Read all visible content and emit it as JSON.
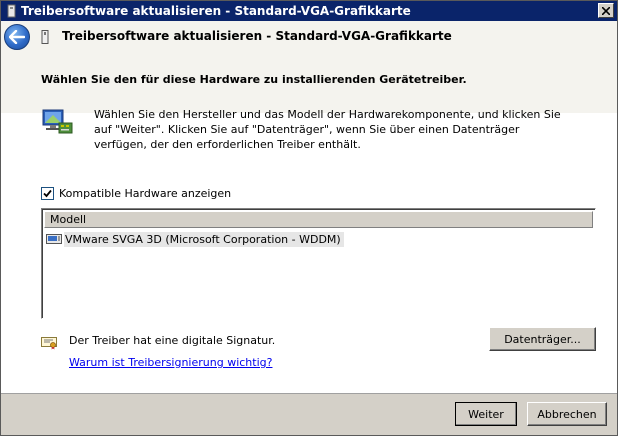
{
  "window": {
    "title": "Treibersoftware aktualisieren - Standard-VGA-Grafikkarte",
    "close_label": "✕"
  },
  "header": {
    "title": "Treibersoftware aktualisieren - Standard-VGA-Grafikkarte",
    "back_icon": "arrow-left-icon"
  },
  "main": {
    "heading": "Wählen Sie den für diese Hardware zu installierenden Gerätetreiber.",
    "description": "Wählen Sie den Hersteller und das Modell der Hardwarekomponente, und klicken Sie auf \"Weiter\". Klicken Sie auf \"Datenträger\", wenn Sie über einen Datenträger verfügen, der den erforderlichen Treiber enthält.",
    "compatible_checkbox": {
      "label": "Kompatible Hardware anzeigen",
      "checked": true
    },
    "model_list": {
      "column_header": "Modell",
      "items": [
        {
          "label": "VMware SVGA 3D (Microsoft Corporation - WDDM)",
          "selected": true
        }
      ]
    },
    "signature": {
      "text": "Der Treiber hat eine digitale Signatur.",
      "link": "Warum ist Treibersignierung wichtig?"
    },
    "disk_button": "Datenträger..."
  },
  "footer": {
    "next_button": "Weiter",
    "cancel_button": "Abbrechen"
  },
  "colors": {
    "titlebar": "#0a246a",
    "link": "#0000ee",
    "dialog_bg": "#d4d0c8"
  }
}
